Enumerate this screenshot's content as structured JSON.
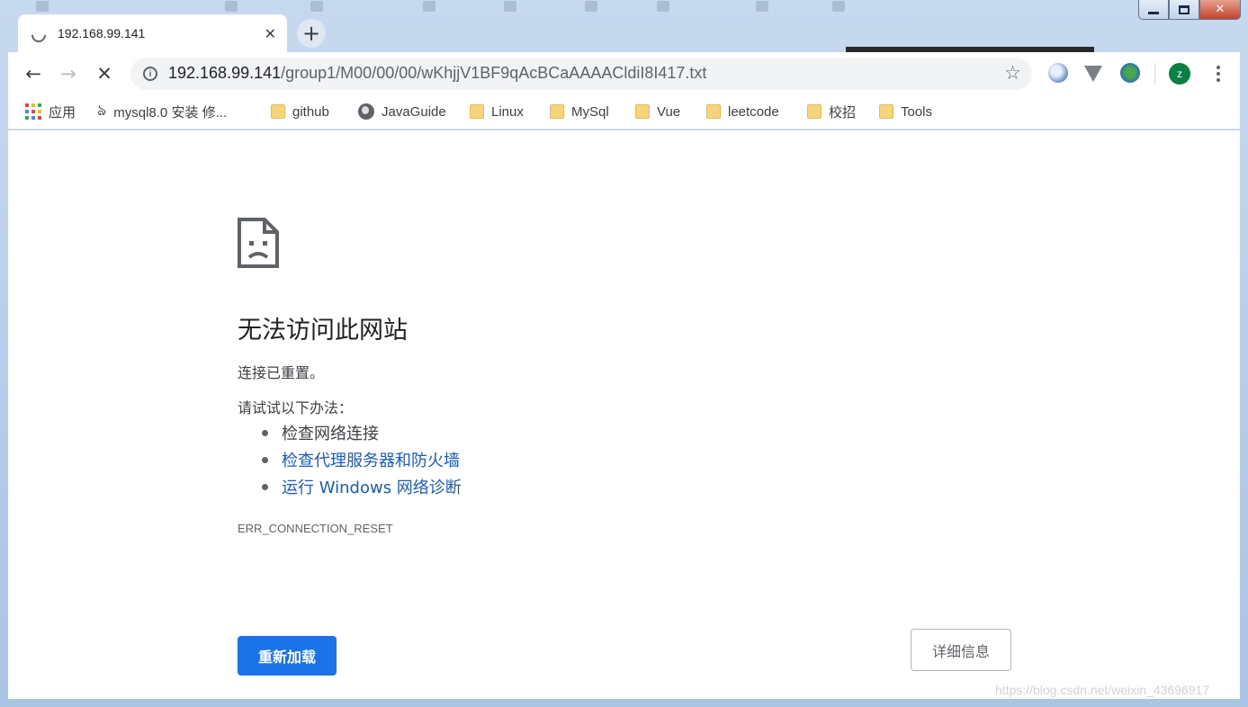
{
  "window": {
    "minimize_label": "",
    "maximize_label": "",
    "close_label": "✕"
  },
  "tab": {
    "title": "192.168.99.141",
    "close_glyph": "✕",
    "new_tab_glyph": "+"
  },
  "toolbar": {
    "back_glyph": "←",
    "forward_glyph": "→",
    "stop_glyph": "✕",
    "url_host": "192.168.99.141",
    "url_path": "/group1/M00/00/00/wKhjjV1BF9qAcBCaAAAACldiI8I417.txt",
    "star_glyph": "☆",
    "avatar_letter": "z"
  },
  "bookmarks": [
    {
      "label": "应用",
      "icon": "apps-grid-icon"
    },
    {
      "label": "mysql8.0 安装 修...",
      "icon": "mysql-dolphin-icon"
    },
    {
      "label": "github",
      "icon": "folder-icon"
    },
    {
      "label": "JavaGuide",
      "icon": "globe-icon"
    },
    {
      "label": "Linux",
      "icon": "folder-icon"
    },
    {
      "label": "MySql",
      "icon": "folder-icon"
    },
    {
      "label": "Vue",
      "icon": "folder-icon"
    },
    {
      "label": "leetcode",
      "icon": "folder-icon"
    },
    {
      "label": "校招",
      "icon": "folder-icon"
    },
    {
      "label": "Tools",
      "icon": "folder-icon"
    }
  ],
  "error_page": {
    "title": "无法访问此网站",
    "subtitle": "连接已重置。",
    "try_label": "请试试以下办法：",
    "suggestions": [
      {
        "text": "检查网络连接",
        "link": false
      },
      {
        "text": "检查代理服务器和防火墙",
        "link": true
      },
      {
        "text": "运行 Windows 网络诊断",
        "link": true
      }
    ],
    "error_code": "ERR_CONNECTION_RESET",
    "reload_label": "重新加载",
    "details_label": "详细信息"
  },
  "watermark": "https://blog.csdn.net/weixin_43696917",
  "colors": {
    "primary_button": "#1a73e8",
    "link": "#1a5bbf",
    "avatar": "#0b8043"
  }
}
